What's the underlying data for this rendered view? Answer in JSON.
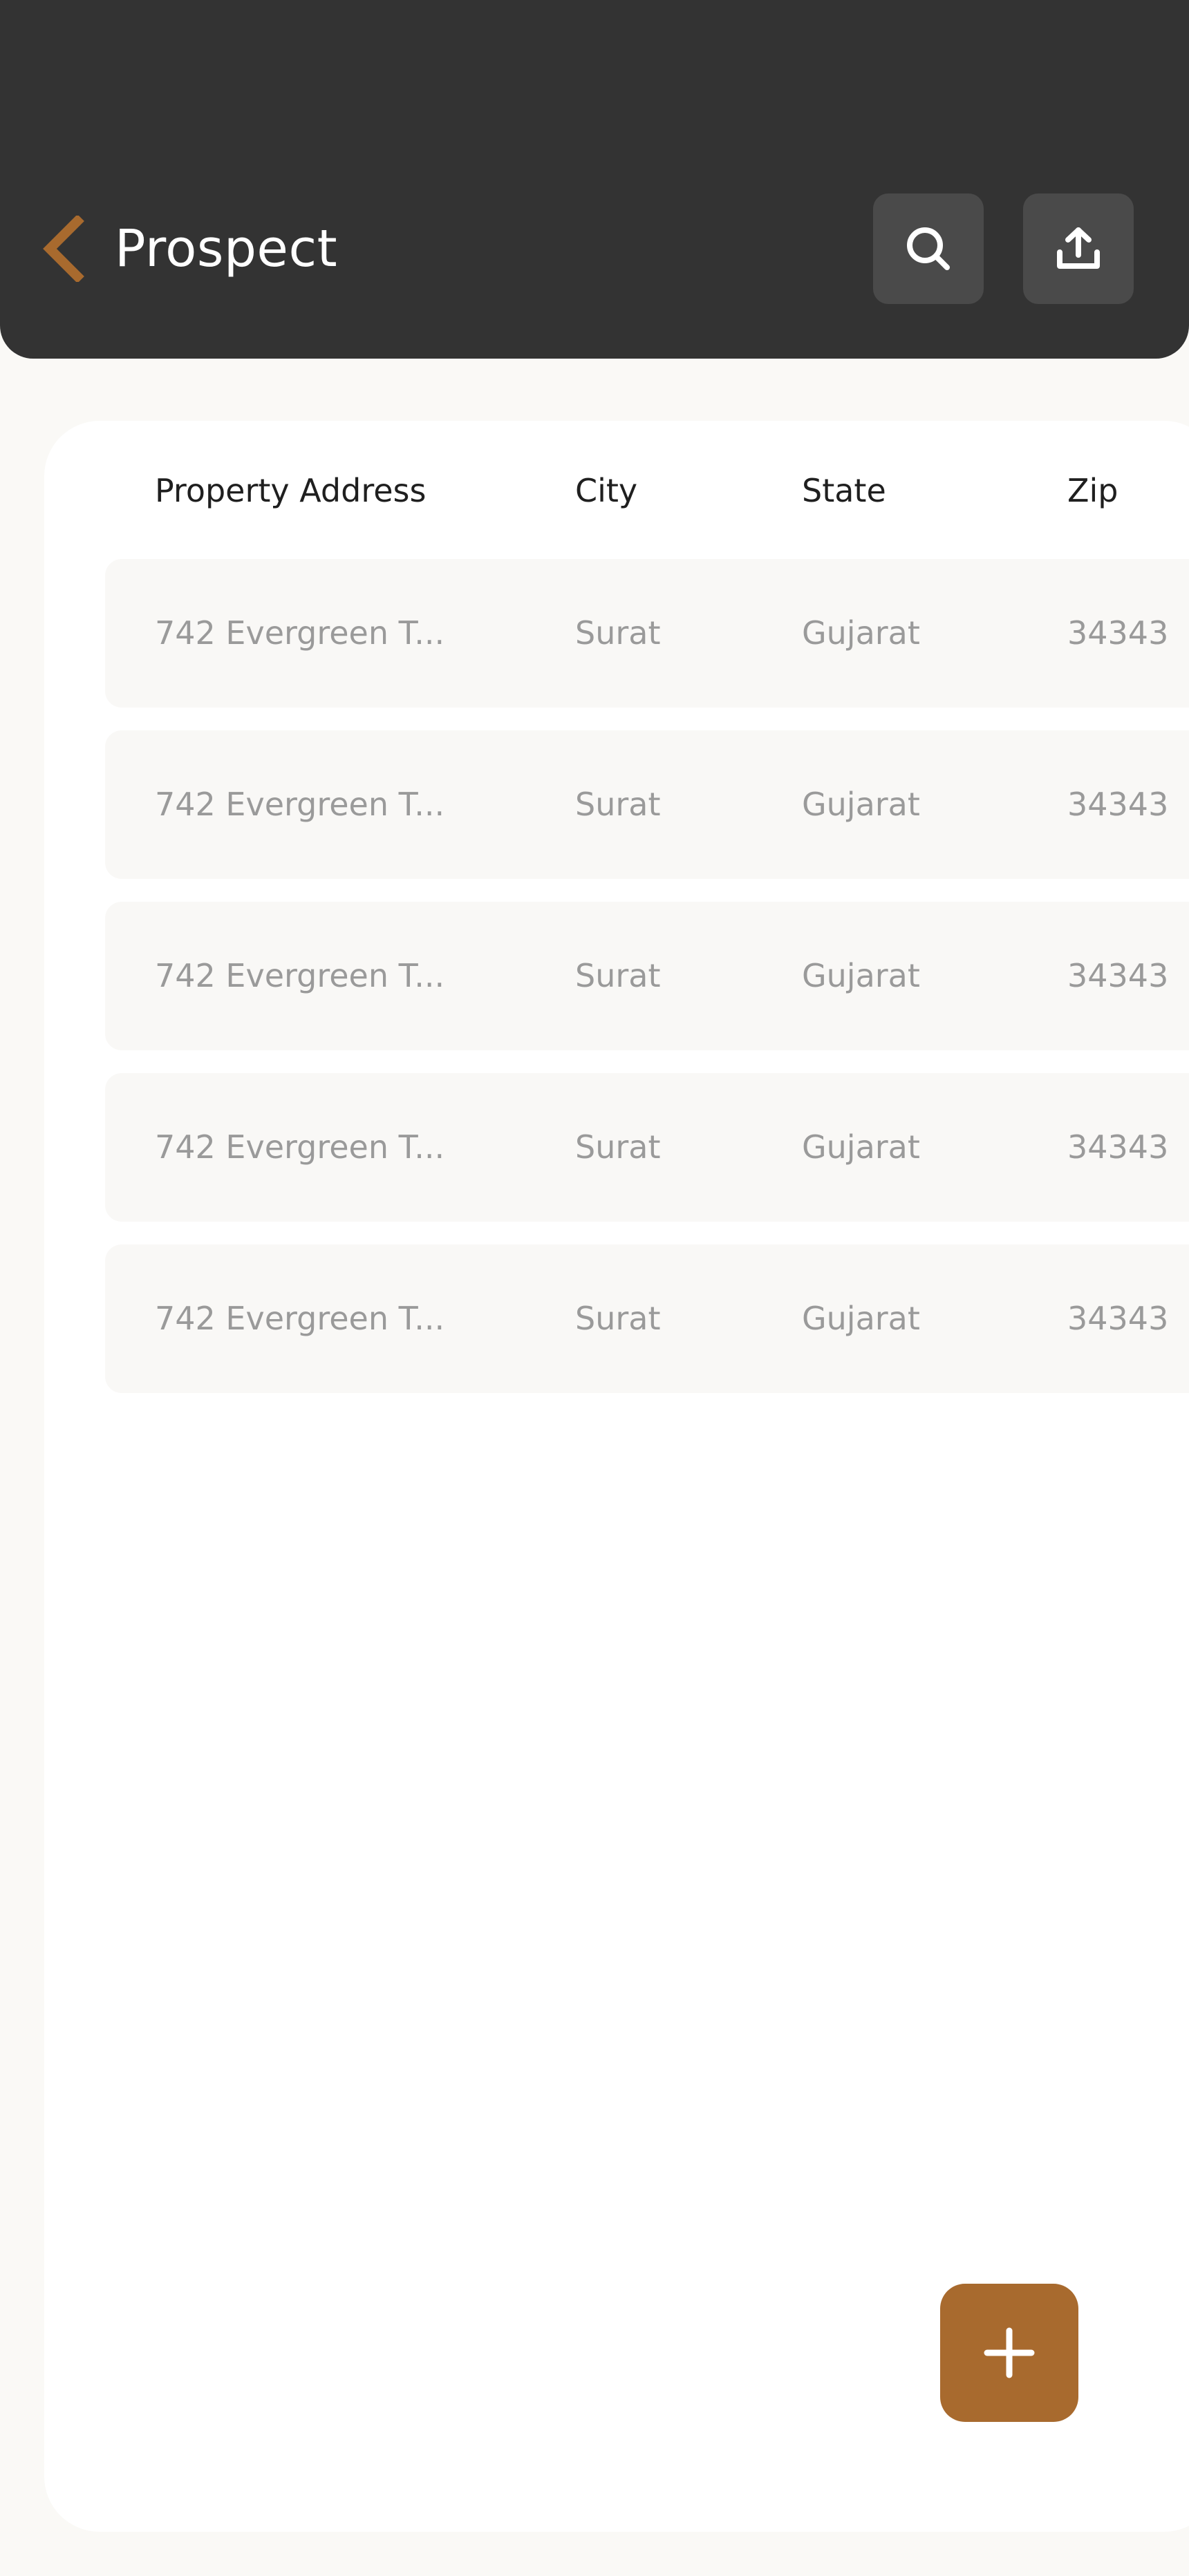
{
  "header": {
    "title": "Prospect",
    "back_icon": "chevron-left-icon",
    "search_icon": "search-icon",
    "export_icon": "upload-icon",
    "accent_color": "#a86a2e",
    "bg_color": "#333333"
  },
  "table": {
    "columns": [
      "Property Address",
      "City",
      "State",
      "Zip"
    ],
    "rows": [
      {
        "address": "742 Evergreen T...",
        "city": "Surat",
        "state": "Gujarat",
        "zip": "34343"
      },
      {
        "address": "742 Evergreen T...",
        "city": "Surat",
        "state": "Gujarat",
        "zip": "34343"
      },
      {
        "address": "742 Evergreen T...",
        "city": "Surat",
        "state": "Gujarat",
        "zip": "34343"
      },
      {
        "address": "742 Evergreen T...",
        "city": "Surat",
        "state": "Gujarat",
        "zip": "34343"
      },
      {
        "address": "742 Evergreen T...",
        "city": "Surat",
        "state": "Gujarat",
        "zip": "34343"
      }
    ]
  },
  "fab": {
    "icon": "plus-icon",
    "color": "#a86a2e"
  }
}
